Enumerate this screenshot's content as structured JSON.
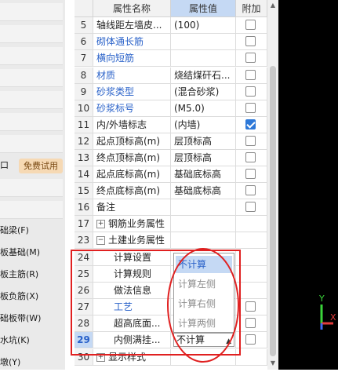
{
  "left_panel": {
    "mini_text": "口",
    "free_trial_label": "免费试用",
    "items": [
      {
        "label": "础梁(F)"
      },
      {
        "label": "板基础(M)"
      },
      {
        "label": "板主筋(R)"
      },
      {
        "label": "板负筋(X)"
      },
      {
        "label": "础板带(W)"
      },
      {
        "label": "水坑(K)"
      },
      {
        "label": "墩(Y)"
      }
    ]
  },
  "grid": {
    "headers": {
      "name": "属性名称",
      "value": "属性值",
      "add": "附加"
    },
    "rows": [
      {
        "idx": "5",
        "name": "轴线距左墙皮...",
        "value": "(100)",
        "link": false,
        "checked": false
      },
      {
        "idx": "6",
        "name": "砌体通长筋",
        "value": "",
        "link": true,
        "checked": false
      },
      {
        "idx": "7",
        "name": "横向短筋",
        "value": "",
        "link": true,
        "checked": false
      },
      {
        "idx": "8",
        "name": "材质",
        "value": "烧结煤矸石...",
        "link": true,
        "checked": false
      },
      {
        "idx": "9",
        "name": "砂浆类型",
        "value": "(混合砂浆)",
        "link": true,
        "checked": false
      },
      {
        "idx": "10",
        "name": "砂浆标号",
        "value": "(M5.0)",
        "link": true,
        "checked": false
      },
      {
        "idx": "11",
        "name": "内/外墙标志",
        "value": "(内墙)",
        "link": false,
        "checked": true
      },
      {
        "idx": "12",
        "name": "起点顶标高(m)",
        "value": "层顶标高",
        "link": false,
        "checked": false
      },
      {
        "idx": "13",
        "name": "终点顶标高(m)",
        "value": "层顶标高",
        "link": false,
        "checked": false
      },
      {
        "idx": "14",
        "name": "起点底标高(m)",
        "value": "基础底标高",
        "link": false,
        "checked": false
      },
      {
        "idx": "15",
        "name": "终点底标高(m)",
        "value": "基础底标高",
        "link": false,
        "checked": false
      },
      {
        "idx": "16",
        "name": "备注",
        "value": "",
        "link": false,
        "checked": false
      },
      {
        "idx": "17",
        "name": "钢筋业务属性",
        "value": "",
        "link": false,
        "group": "+"
      },
      {
        "idx": "23",
        "name": "土建业务属性",
        "value": "",
        "link": false,
        "group": "-"
      },
      {
        "idx": "24",
        "name": "计算设置",
        "value": "",
        "link": false,
        "indent": true
      },
      {
        "idx": "25",
        "name": "计算规则",
        "value": "",
        "link": false,
        "indent": true
      },
      {
        "idx": "26",
        "name": "做法信息",
        "value": "",
        "link": false,
        "indent": true
      },
      {
        "idx": "27",
        "name": "工艺",
        "value": "",
        "link": true,
        "indent": true,
        "checked": false
      },
      {
        "idx": "28",
        "name": "超高底面...",
        "value": "",
        "link": false,
        "indent": true,
        "checked": false
      },
      {
        "idx": "29",
        "name": "内侧满挂...",
        "value": "",
        "link": false,
        "indent": true,
        "checked": false,
        "selected": true
      },
      {
        "idx": "30",
        "name": "显示样式",
        "value": "",
        "link": false,
        "group": "+"
      }
    ]
  },
  "dropdown": {
    "options": [
      "不计算",
      "计算左侧",
      "计算右侧",
      "计算两侧"
    ],
    "selected_value": "不计算"
  },
  "viewport": {
    "axis_labels": {
      "y": "Y",
      "x": "X"
    },
    "colors": {
      "x_axis": "#e33b3b",
      "y_axis": "#3ad43a",
      "z_axis": "#3f6af0",
      "background": "#000000"
    }
  },
  "colors": {
    "accent": "#2a62c9",
    "header_highlight": "#c5d9f4",
    "annotation_red": "#e02020",
    "badge_bg": "#f6d9b4"
  }
}
